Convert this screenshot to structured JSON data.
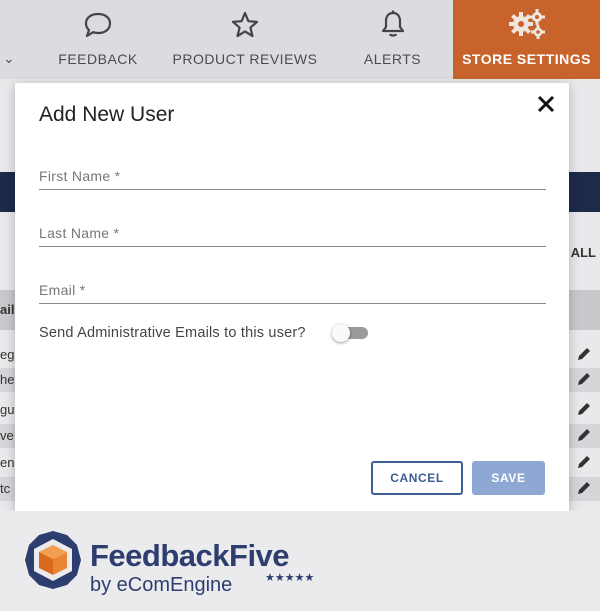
{
  "nav": {
    "items": [
      {
        "label": "FEEDBACK",
        "icon": "speech-bubble-icon"
      },
      {
        "label": "PRODUCT REVIEWS",
        "icon": "star-icon"
      },
      {
        "label": "ALERTS",
        "icon": "bell-icon"
      },
      {
        "label": "STORE SETTINGS",
        "icon": "gears-icon",
        "active": true
      }
    ],
    "active_color": "#c8642b"
  },
  "background": {
    "all_label": "ALL",
    "header_fragment": "ail",
    "row_fragments": [
      "eg",
      "he",
      "gu",
      "ve",
      "en",
      "tc"
    ]
  },
  "modal": {
    "title": "Add New User",
    "fields": {
      "first_name": {
        "placeholder": "First Name *",
        "value": ""
      },
      "last_name": {
        "placeholder": "Last Name *",
        "value": ""
      },
      "email": {
        "placeholder": "Email *",
        "value": ""
      }
    },
    "admin_emails_label": "Send Administrative Emails to this user?",
    "admin_emails_enabled": false,
    "cancel_label": "CANCEL",
    "save_label": "SAVE"
  },
  "brand": {
    "name": "FeedbackFive",
    "sub": "by eComEngine",
    "stars": "★★★★★",
    "color": "#2d3e6e",
    "accent": "#e07b2a"
  }
}
